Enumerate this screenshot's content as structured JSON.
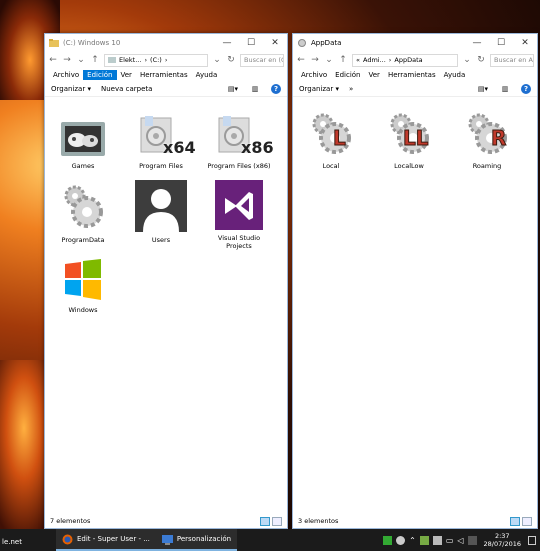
{
  "desktop": {
    "left_text": "le.net"
  },
  "left_window": {
    "title": "(C:) Windows 10",
    "controls": {
      "minimize": "—",
      "maximize": "☐",
      "close": "✕"
    },
    "path": [
      "Elekt...",
      "(C:)"
    ],
    "search_placeholder": "Buscar en (C:)",
    "menu": [
      "Archivo",
      "Edición",
      "Ver",
      "Herramientas",
      "Ayuda"
    ],
    "active_menu_index": 1,
    "commands": {
      "organize": "Organizar ▾",
      "new_folder": "Nueva carpeta"
    },
    "items": [
      {
        "name": "Games",
        "icon": "games-folder-icon"
      },
      {
        "name": "Program Files",
        "icon": "program-files-icon",
        "badge": "x64"
      },
      {
        "name": "Program Files (x86)",
        "icon": "program-files-icon",
        "badge": "x86"
      },
      {
        "name": "ProgramData",
        "icon": "gear-folder-icon"
      },
      {
        "name": "Users",
        "icon": "user-icon"
      },
      {
        "name": "Visual Studio Projects",
        "icon": "visual-studio-icon"
      },
      {
        "name": "Windows",
        "icon": "windows-logo-icon"
      }
    ],
    "status": "7 elementos"
  },
  "right_window": {
    "title": "AppData",
    "controls": {
      "minimize": "—",
      "maximize": "☐",
      "close": "✕"
    },
    "path": [
      "«",
      "Admi...",
      "AppData"
    ],
    "search_placeholder": "Buscar en Ap",
    "menu": [
      "Archivo",
      "Edición",
      "Ver",
      "Herramientas",
      "Ayuda"
    ],
    "commands": {
      "organize": "Organizar ▾",
      "more": "»"
    },
    "items": [
      {
        "name": "Local",
        "icon": "gear-folder-icon",
        "badge": "L"
      },
      {
        "name": "LocalLow",
        "icon": "gear-folder-icon",
        "badge": "LL"
      },
      {
        "name": "Roaming",
        "icon": "gear-folder-icon",
        "badge": "R"
      }
    ],
    "status": "3 elementos"
  },
  "taskbar": {
    "apps": [
      {
        "label": "Edit - Super User - ..."
      },
      {
        "label": "Personalización"
      }
    ],
    "time": "2:37",
    "date": "28/07/2016"
  },
  "colors": {
    "accent": "#0078d7",
    "vs_purple": "#68217a",
    "badge_red": "#c0392b"
  }
}
